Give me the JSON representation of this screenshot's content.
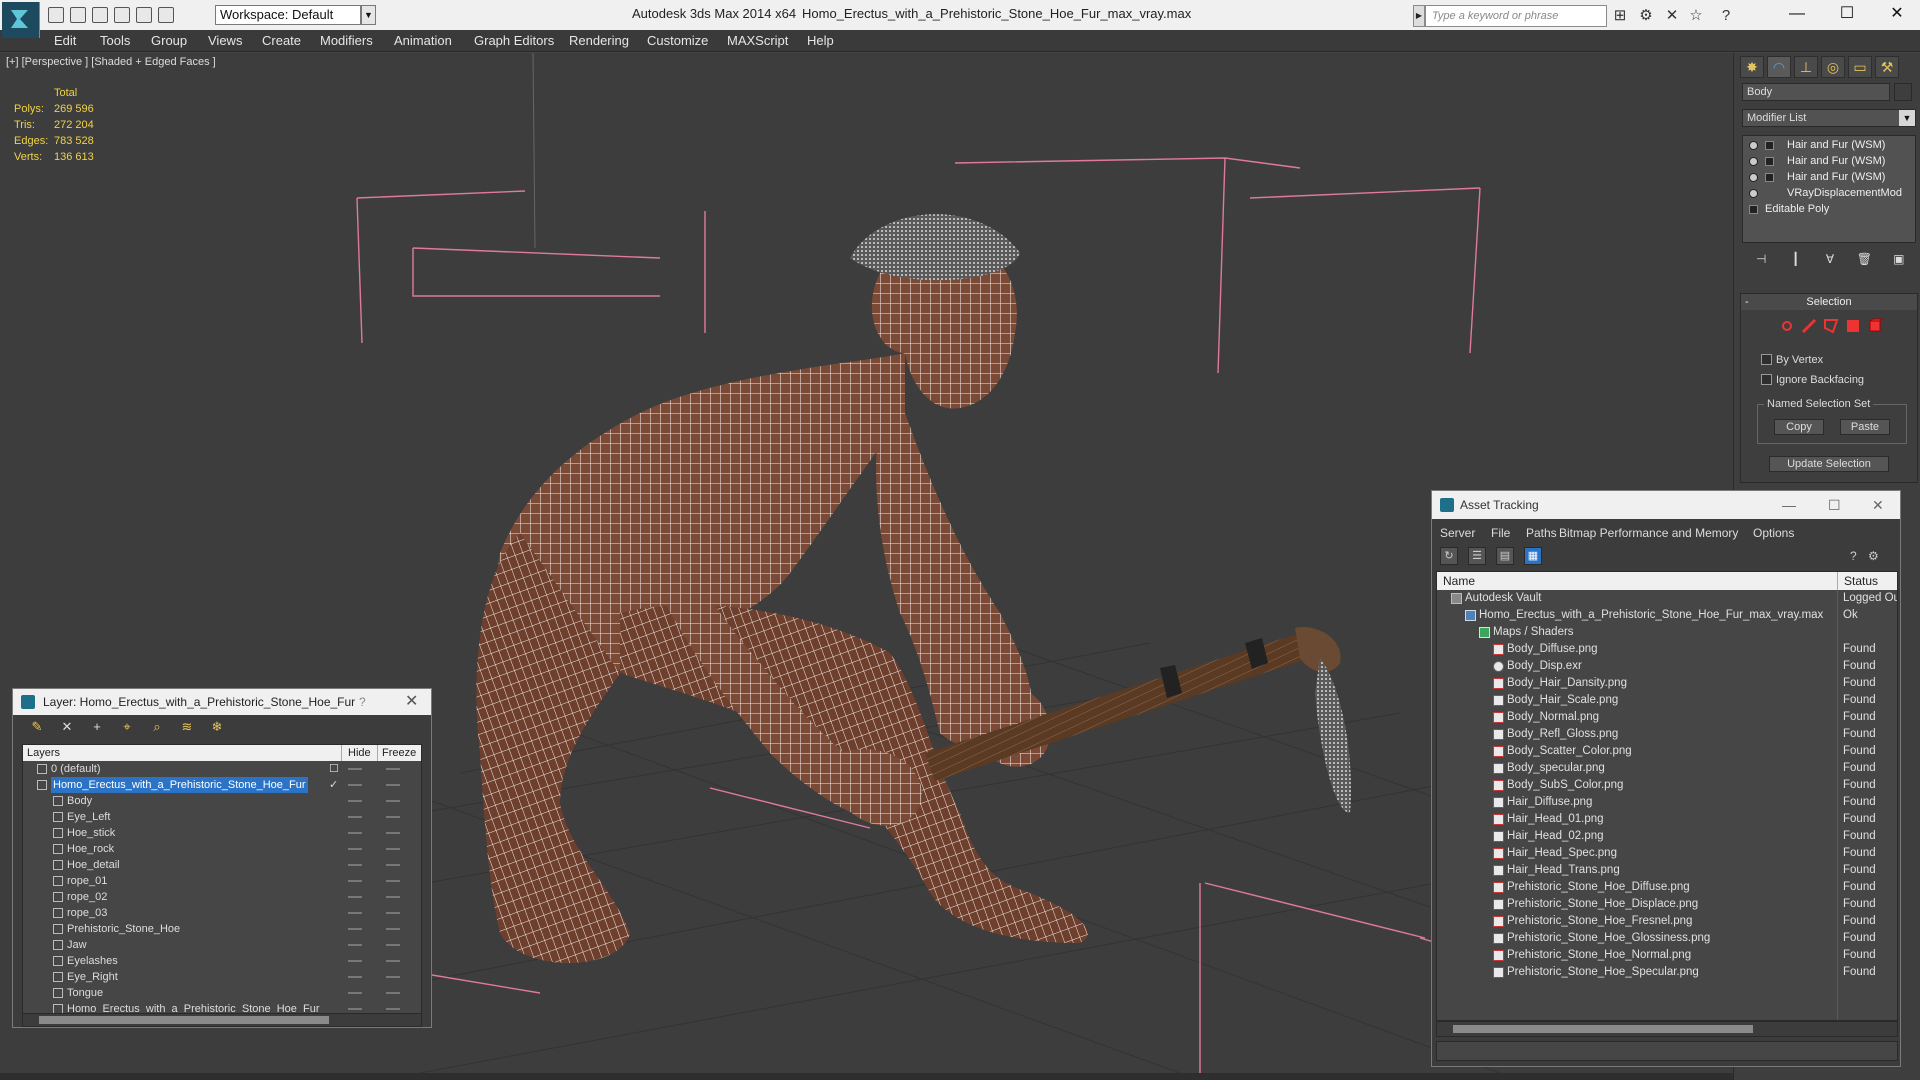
{
  "titlebar": {
    "workspace": "Workspace: Default",
    "app_name": "Autodesk 3ds Max  2014 x64",
    "file_name": "Homo_Erectus_with_a_Prehistoric_Stone_Hoe_Fur_max_vray.max",
    "search_placeholder": "Type a keyword or phrase"
  },
  "menubar": {
    "items": [
      "Edit",
      "Tools",
      "Group",
      "Views",
      "Create",
      "Modifiers",
      "Animation",
      "Graph Editors",
      "Rendering",
      "Customize",
      "MAXScript",
      "Help"
    ]
  },
  "viewport": {
    "label": "[+] [Perspective ] [Shaded + Edged Faces ]",
    "stats": {
      "header": "Total",
      "rows": [
        {
          "label": "Polys:",
          "value": "269 596"
        },
        {
          "label": "Tris:",
          "value": "272 204"
        },
        {
          "label": "Edges:",
          "value": "783 528"
        },
        {
          "label": "Verts:",
          "value": "136 613"
        }
      ]
    }
  },
  "command_panel": {
    "object_name": "Body",
    "modifier_list": "Modifier List",
    "stack": [
      "Hair and Fur (WSM)",
      "Hair and Fur (WSM)",
      "Hair and Fur (WSM)",
      "VRayDisplacementMod",
      "Editable Poly"
    ],
    "selection": {
      "title": "Selection",
      "by_vertex": "By Vertex",
      "ignore_backfacing": "Ignore Backfacing",
      "named_selection_set": "Named Selection Set",
      "copy": "Copy",
      "paste": "Paste",
      "update_selection": "Update Selection"
    }
  },
  "layer_window": {
    "title": "Layer: Homo_Erectus_with_a_Prehistoric_Stone_Hoe_Fur",
    "help": "?",
    "columns": {
      "layers": "Layers",
      "hide": "Hide",
      "freeze": "Freeze"
    },
    "rows": [
      {
        "name": "0 (default)",
        "level": 0
      },
      {
        "name": "Homo_Erectus_with_a_Prehistoric_Stone_Hoe_Fur",
        "level": 0,
        "selected": true
      },
      {
        "name": "Body",
        "level": 1
      },
      {
        "name": "Eye_Left",
        "level": 1
      },
      {
        "name": "Hoe_stick",
        "level": 1
      },
      {
        "name": "Hoe_rock",
        "level": 1
      },
      {
        "name": "Hoe_detail",
        "level": 1
      },
      {
        "name": "rope_01",
        "level": 1
      },
      {
        "name": "rope_02",
        "level": 1
      },
      {
        "name": "rope_03",
        "level": 1
      },
      {
        "name": "Prehistoric_Stone_Hoe",
        "level": 1
      },
      {
        "name": "Jaw",
        "level": 1
      },
      {
        "name": "Eyelashes",
        "level": 1
      },
      {
        "name": "Eye_Right",
        "level": 1
      },
      {
        "name": "Tongue",
        "level": 1
      },
      {
        "name": "Homo_Erectus_with_a_Prehistoric_Stone_Hoe_Fur",
        "level": 1
      }
    ]
  },
  "asset_window": {
    "title": "Asset Tracking",
    "menu": [
      "Server",
      "File",
      "Paths",
      "Bitmap Performance and Memory",
      "Options"
    ],
    "columns": {
      "name": "Name",
      "status": "Status"
    },
    "rows": [
      {
        "name": "Autodesk Vault",
        "status": "Logged Ou",
        "level": 0,
        "icon": "vault"
      },
      {
        "name": "Homo_Erectus_with_a_Prehistoric_Stone_Hoe_Fur_max_vray.max",
        "status": "Ok",
        "level": 1,
        "icon": "max"
      },
      {
        "name": "Maps / Shaders",
        "status": "",
        "level": 2,
        "icon": "folder"
      },
      {
        "name": "Body_Diffuse.png",
        "status": "Found",
        "level": 3,
        "icon": "png"
      },
      {
        "name": "Body_Disp.exr",
        "status": "Found",
        "level": 3,
        "icon": "exr"
      },
      {
        "name": "Body_Hair_Dansity.png",
        "status": "Found",
        "level": 3,
        "icon": "png"
      },
      {
        "name": "Body_Hair_Scale.png",
        "status": "Found",
        "level": 3,
        "icon": "png"
      },
      {
        "name": "Body_Normal.png",
        "status": "Found",
        "level": 3,
        "icon": "png"
      },
      {
        "name": "Body_Refl_Gloss.png",
        "status": "Found",
        "level": 3,
        "icon": "png"
      },
      {
        "name": "Body_Scatter_Color.png",
        "status": "Found",
        "level": 3,
        "icon": "png"
      },
      {
        "name": "Body_specular.png",
        "status": "Found",
        "level": 3,
        "icon": "png"
      },
      {
        "name": "Body_SubS_Color.png",
        "status": "Found",
        "level": 3,
        "icon": "png"
      },
      {
        "name": "Hair_Diffuse.png",
        "status": "Found",
        "level": 3,
        "icon": "png"
      },
      {
        "name": "Hair_Head_01.png",
        "status": "Found",
        "level": 3,
        "icon": "png"
      },
      {
        "name": "Hair_Head_02.png",
        "status": "Found",
        "level": 3,
        "icon": "png"
      },
      {
        "name": "Hair_Head_Spec.png",
        "status": "Found",
        "level": 3,
        "icon": "png"
      },
      {
        "name": "Hair_Head_Trans.png",
        "status": "Found",
        "level": 3,
        "icon": "png"
      },
      {
        "name": "Prehistoric_Stone_Hoe_Diffuse.png",
        "status": "Found",
        "level": 3,
        "icon": "png"
      },
      {
        "name": "Prehistoric_Stone_Hoe_Displace.png",
        "status": "Found",
        "level": 3,
        "icon": "png"
      },
      {
        "name": "Prehistoric_Stone_Hoe_Fresnel.png",
        "status": "Found",
        "level": 3,
        "icon": "png"
      },
      {
        "name": "Prehistoric_Stone_Hoe_Glossiness.png",
        "status": "Found",
        "level": 3,
        "icon": "png"
      },
      {
        "name": "Prehistoric_Stone_Hoe_Normal.png",
        "status": "Found",
        "level": 3,
        "icon": "png"
      },
      {
        "name": "Prehistoric_Stone_Hoe_Specular.png",
        "status": "Found",
        "level": 3,
        "icon": "png"
      }
    ]
  },
  "colors": {
    "stats_text": "#f0d246",
    "selection_blue": "#2a73c7",
    "skin": "#7a4a36",
    "wire": "#f2ebe6",
    "bbox": "#e07a9a"
  }
}
